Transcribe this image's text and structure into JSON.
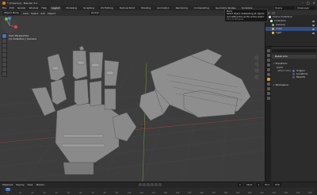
{
  "window": {
    "title": "* (Unsaved) - Blender 4.2"
  },
  "menubar": {
    "menus": [
      "File",
      "Edit",
      "Render",
      "Window",
      "Help"
    ],
    "workspaces": [
      "Layout",
      "Modeling",
      "Sculpting",
      "UV Editing",
      "Texture Paint",
      "Shading",
      "Animation",
      "Rendering",
      "Compositing",
      "Geometry Nodes",
      "Scripting"
    ],
    "active_workspace": "Layout",
    "scene": "Scene",
    "view_layer": "ViewLayer"
  },
  "viewport_header": {
    "mode": "Object Mode",
    "menus": [
      "View",
      "Select",
      "Add",
      "Object"
    ],
    "orientation": "Global"
  },
  "viewport": {
    "view_name": "User Perspective",
    "collection_path": "(1) Collection | Camera"
  },
  "tooltip": {
    "title": "Menu",
    "description": "Select object, deselecting all objects and setting this as the active object.",
    "hint": "Click to Rename"
  },
  "outliner": {
    "rows": [
      {
        "label": "Scene Collection",
        "selected": false
      },
      {
        "label": "Collection",
        "selected": false
      },
      {
        "label": "Camera",
        "selected": false
      },
      {
        "label": "Cube",
        "selected": true
      },
      {
        "label": "Light",
        "selected": false
      }
    ]
  },
  "properties": {
    "object_name": "Robot Arm",
    "panels": [
      "Transform",
      "Delta Transform",
      "Relations",
      "Collections",
      "Instancing",
      "Motion Paths",
      "Visibility"
    ],
    "delta_label": "Delta",
    "affect_only_label": "Affect Only",
    "affect_options": [
      "Origins",
      "Locations",
      "Parents"
    ],
    "workspace_label": "Workspace"
  },
  "timeline": {
    "menus": [
      "Playback",
      "Keying",
      "View",
      "Marker"
    ],
    "current_frame": "1",
    "start_label": "Start",
    "start": "1",
    "end_label": "End",
    "end": "250",
    "ruler_ticks": [
      "0",
      "10",
      "20",
      "30",
      "40",
      "50",
      "60",
      "70",
      "80",
      "90",
      "100",
      "110",
      "120",
      "130",
      "140",
      "150",
      "160",
      "170",
      "180",
      "190",
      "200",
      "210",
      "220",
      "230",
      "240",
      "250"
    ]
  },
  "colors": {
    "accent": "#4772b3",
    "selection": "#e89b2a",
    "viewport_bg": "#3d3d3d"
  }
}
